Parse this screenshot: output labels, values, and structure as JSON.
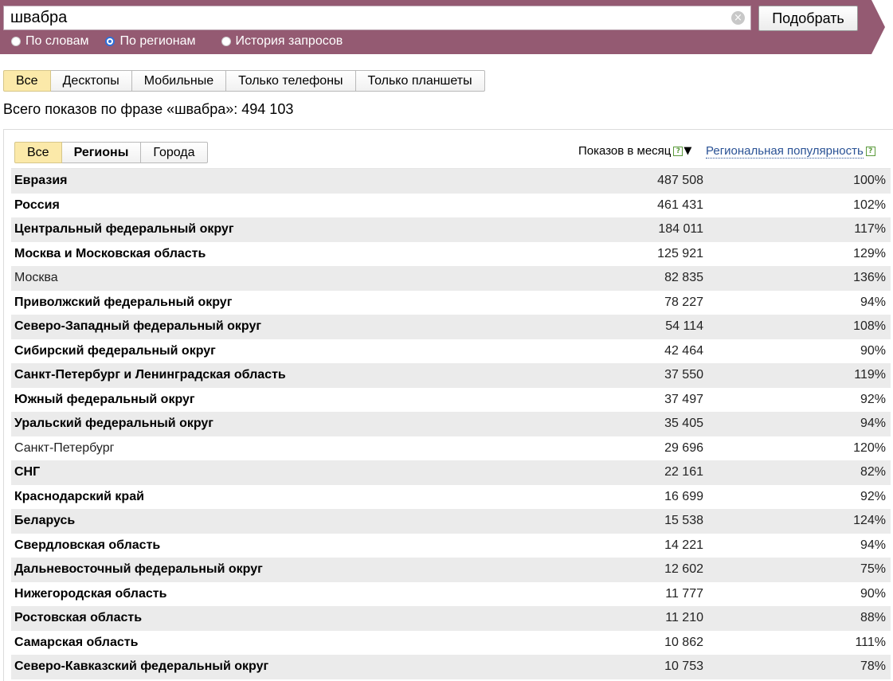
{
  "search": {
    "query": "швабра",
    "submit_label": "Подобрать",
    "clear_glyph": "×"
  },
  "modes": [
    {
      "label": "По словам",
      "checked": false
    },
    {
      "label": "По регионам",
      "checked": true
    },
    {
      "label": "История запросов",
      "checked": false
    }
  ],
  "device_tabs": [
    {
      "label": "Все",
      "active": true
    },
    {
      "label": "Десктопы",
      "active": false
    },
    {
      "label": "Мобильные",
      "active": false
    },
    {
      "label": "Только телефоны",
      "active": false
    },
    {
      "label": "Только планшеты",
      "active": false
    }
  ],
  "total_line": "Всего показов по фразе «швабра»: 494 103",
  "region_tabs": [
    {
      "label": "Все",
      "active": true,
      "bold": false
    },
    {
      "label": "Регионы",
      "active": false,
      "bold": true
    },
    {
      "label": "Города",
      "active": false,
      "bold": false
    }
  ],
  "columns": {
    "shows": "Показов в месяц",
    "popularity": "Региональная популярность",
    "help_glyph": "?",
    "sort_glyph": "▼"
  },
  "rows": [
    {
      "name": "Евразия",
      "shows": "487 508",
      "pct": "100%",
      "bold": true
    },
    {
      "name": "Россия",
      "shows": "461 431",
      "pct": "102%",
      "bold": true
    },
    {
      "name": "Центральный федеральный округ",
      "shows": "184 011",
      "pct": "117%",
      "bold": true
    },
    {
      "name": "Москва и Московская область",
      "shows": "125 921",
      "pct": "129%",
      "bold": true
    },
    {
      "name": "Москва",
      "shows": "82 835",
      "pct": "136%",
      "bold": false
    },
    {
      "name": "Приволжский федеральный округ",
      "shows": "78 227",
      "pct": "94%",
      "bold": true
    },
    {
      "name": "Северо-Западный федеральный округ",
      "shows": "54 114",
      "pct": "108%",
      "bold": true
    },
    {
      "name": "Сибирский федеральный округ",
      "shows": "42 464",
      "pct": "90%",
      "bold": true
    },
    {
      "name": "Санкт-Петербург и Ленинградская область",
      "shows": "37 550",
      "pct": "119%",
      "bold": true
    },
    {
      "name": "Южный федеральный округ",
      "shows": "37 497",
      "pct": "92%",
      "bold": true
    },
    {
      "name": "Уральский федеральный округ",
      "shows": "35 405",
      "pct": "94%",
      "bold": true
    },
    {
      "name": "Санкт-Петербург",
      "shows": "29 696",
      "pct": "120%",
      "bold": false
    },
    {
      "name": "СНГ",
      "shows": "22 161",
      "pct": "82%",
      "bold": true
    },
    {
      "name": "Краснодарский край",
      "shows": "16 699",
      "pct": "92%",
      "bold": true
    },
    {
      "name": "Беларусь",
      "shows": "15 538",
      "pct": "124%",
      "bold": true
    },
    {
      "name": "Свердловская область",
      "shows": "14 221",
      "pct": "94%",
      "bold": true
    },
    {
      "name": "Дальневосточный федеральный округ",
      "shows": "12 602",
      "pct": "75%",
      "bold": true
    },
    {
      "name": "Нижегородская область",
      "shows": "11 777",
      "pct": "90%",
      "bold": true
    },
    {
      "name": "Ростовская область",
      "shows": "11 210",
      "pct": "88%",
      "bold": true
    },
    {
      "name": "Самарская область",
      "shows": "10 862",
      "pct": "111%",
      "bold": true
    },
    {
      "name": "Северо-Кавказский федеральный округ",
      "shows": "10 753",
      "pct": "78%",
      "bold": true
    }
  ],
  "colors": {
    "header_bg": "#945a72",
    "active_tab_bg": "#fbe9a9",
    "link": "#2a5295",
    "zebra": "#ebebeb"
  }
}
